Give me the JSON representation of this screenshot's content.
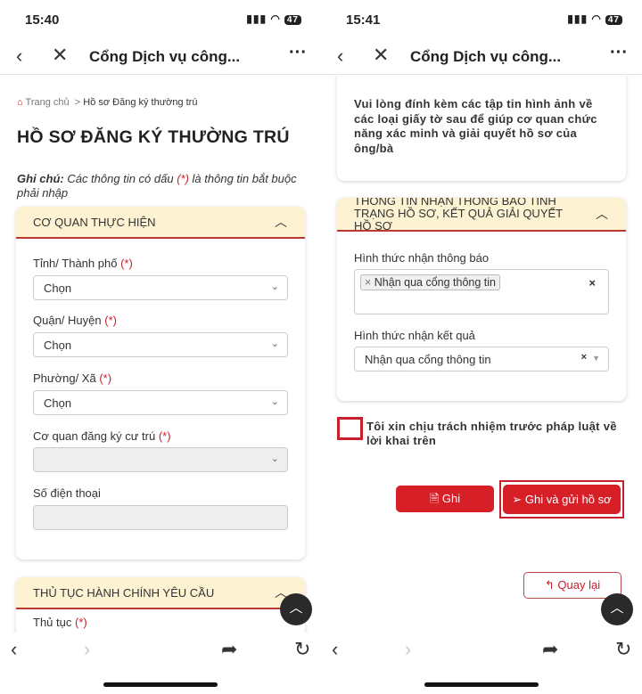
{
  "left": {
    "status": {
      "time": "15:40",
      "battery": "47"
    },
    "nav": {
      "title": "Cổng Dịch vụ công..."
    },
    "breadcrumb": {
      "home": "Trang chủ",
      "sep": ">",
      "current": "Hồ sơ Đăng ký thường trú"
    },
    "page_title": "HỒ SƠ ĐĂNG KÝ THƯỜNG TRÚ",
    "note": {
      "label": "Ghi chú:",
      "text_before": " Các thông tin có dấu ",
      "marker": "(*)",
      "text_after": " là thông tin bắt buộc phải nhập"
    },
    "section1": {
      "title": "CƠ QUAN THỰC HIỆN",
      "fields": [
        {
          "label": "Tỉnh/ Thành phố",
          "required": "(*)",
          "value": "Chọn"
        },
        {
          "label": "Quận/ Huyện",
          "required": "(*)",
          "value": "Chọn"
        },
        {
          "label": "Phường/ Xã",
          "required": "(*)",
          "value": "Chọn"
        },
        {
          "label": "Cơ quan đăng ký cư trú",
          "required": "(*)",
          "value": ""
        },
        {
          "label": "Số điện thoại",
          "value": ""
        }
      ]
    },
    "section2": {
      "title": "THỦ TỤC HÀNH CHÍNH YÊU CẦU",
      "field_label": "Thủ tục",
      "required": "(*)"
    }
  },
  "right": {
    "status": {
      "time": "15:41",
      "battery": "47"
    },
    "nav": {
      "title": "Cổng Dịch vụ công..."
    },
    "attach_note": "Vui lòng đính kèm các tập tin hình ảnh về các loại giấy tờ sau để giúp cơ quan chức năng xác minh và giải quyết hồ sơ của ông/bà",
    "section": {
      "title": "THÔNG TIN NHẬN THÔNG BÁO TÌNH TRẠNG HỒ SƠ, KẾT QUẢ GIẢI QUYẾT HỒ SƠ",
      "notify_label": "Hình thức nhận thông báo",
      "notify_tag": "Nhận qua cổng thông tin",
      "result_label": "Hình thức nhận kết quả",
      "result_value": "Nhận qua cổng thông tin"
    },
    "commitment": "Tôi xin chịu trách nhiệm trước pháp luật về lời khai trên",
    "buttons": {
      "save": "Ghi",
      "save_send": "Ghi và gửi hồ sơ",
      "back": "Quay lại"
    }
  },
  "colors": {
    "accent": "#d71f28",
    "header_bg": "#fdf3d2",
    "highlight": "#c8202b"
  }
}
